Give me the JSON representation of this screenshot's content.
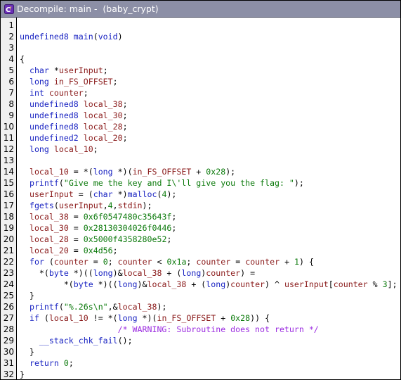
{
  "window": {
    "title": "Decompile: main -  (baby_crypt)",
    "icon": "ghidra-decompiler-icon"
  },
  "colors": {
    "titlebar": "#8c8fa6",
    "keyword": "#1a24c2",
    "variable": "#8a1a1a",
    "number_string": "#0c7a0c",
    "comment": "#9b2be0"
  },
  "code_lines": [
    [],
    [
      {
        "t": "undefined8",
        "c": "type"
      },
      {
        "t": " ",
        "c": "plain"
      },
      {
        "t": "main",
        "c": "func"
      },
      {
        "t": "(",
        "c": "plain"
      },
      {
        "t": "void",
        "c": "type"
      },
      {
        "t": ")",
        "c": "plain"
      }
    ],
    [],
    [
      {
        "t": "{",
        "c": "plain"
      }
    ],
    [
      {
        "t": "  ",
        "c": "plain"
      },
      {
        "t": "char",
        "c": "type"
      },
      {
        "t": " *",
        "c": "plain"
      },
      {
        "t": "userInput",
        "c": "var"
      },
      {
        "t": ";",
        "c": "plain"
      }
    ],
    [
      {
        "t": "  ",
        "c": "plain"
      },
      {
        "t": "long",
        "c": "type"
      },
      {
        "t": " ",
        "c": "plain"
      },
      {
        "t": "in_FS_OFFSET",
        "c": "var"
      },
      {
        "t": ";",
        "c": "plain"
      }
    ],
    [
      {
        "t": "  ",
        "c": "plain"
      },
      {
        "t": "int",
        "c": "type"
      },
      {
        "t": " ",
        "c": "plain"
      },
      {
        "t": "counter",
        "c": "var"
      },
      {
        "t": ";",
        "c": "plain"
      }
    ],
    [
      {
        "t": "  ",
        "c": "plain"
      },
      {
        "t": "undefined8",
        "c": "type"
      },
      {
        "t": " ",
        "c": "plain"
      },
      {
        "t": "local_38",
        "c": "var"
      },
      {
        "t": ";",
        "c": "plain"
      }
    ],
    [
      {
        "t": "  ",
        "c": "plain"
      },
      {
        "t": "undefined8",
        "c": "type"
      },
      {
        "t": " ",
        "c": "plain"
      },
      {
        "t": "local_30",
        "c": "var"
      },
      {
        "t": ";",
        "c": "plain"
      }
    ],
    [
      {
        "t": "  ",
        "c": "plain"
      },
      {
        "t": "undefined8",
        "c": "type"
      },
      {
        "t": " ",
        "c": "plain"
      },
      {
        "t": "local_28",
        "c": "var"
      },
      {
        "t": ";",
        "c": "plain"
      }
    ],
    [
      {
        "t": "  ",
        "c": "plain"
      },
      {
        "t": "undefined2",
        "c": "type"
      },
      {
        "t": " ",
        "c": "plain"
      },
      {
        "t": "local_20",
        "c": "var"
      },
      {
        "t": ";",
        "c": "plain"
      }
    ],
    [
      {
        "t": "  ",
        "c": "plain"
      },
      {
        "t": "long",
        "c": "type"
      },
      {
        "t": " ",
        "c": "plain"
      },
      {
        "t": "local_10",
        "c": "var"
      },
      {
        "t": ";",
        "c": "plain"
      }
    ],
    [],
    [
      {
        "t": "  ",
        "c": "plain"
      },
      {
        "t": "local_10",
        "c": "var"
      },
      {
        "t": " = *(",
        "c": "plain"
      },
      {
        "t": "long",
        "c": "type"
      },
      {
        "t": " *)(",
        "c": "plain"
      },
      {
        "t": "in_FS_OFFSET",
        "c": "var"
      },
      {
        "t": " + ",
        "c": "plain"
      },
      {
        "t": "0x28",
        "c": "num"
      },
      {
        "t": ");",
        "c": "plain"
      }
    ],
    [
      {
        "t": "  ",
        "c": "plain"
      },
      {
        "t": "printf",
        "c": "func"
      },
      {
        "t": "(",
        "c": "plain"
      },
      {
        "t": "\"Give me the key and I\\'ll give you the flag: \"",
        "c": "str"
      },
      {
        "t": ");",
        "c": "plain"
      }
    ],
    [
      {
        "t": "  ",
        "c": "plain"
      },
      {
        "t": "userInput",
        "c": "var"
      },
      {
        "t": " = (",
        "c": "plain"
      },
      {
        "t": "char",
        "c": "type"
      },
      {
        "t": " *)",
        "c": "plain"
      },
      {
        "t": "malloc",
        "c": "func"
      },
      {
        "t": "(",
        "c": "plain"
      },
      {
        "t": "4",
        "c": "num"
      },
      {
        "t": ");",
        "c": "plain"
      }
    ],
    [
      {
        "t": "  ",
        "c": "plain"
      },
      {
        "t": "fgets",
        "c": "func"
      },
      {
        "t": "(",
        "c": "plain"
      },
      {
        "t": "userInput",
        "c": "var"
      },
      {
        "t": ",",
        "c": "plain"
      },
      {
        "t": "4",
        "c": "num"
      },
      {
        "t": ",",
        "c": "plain"
      },
      {
        "t": "stdin",
        "c": "glob"
      },
      {
        "t": ");",
        "c": "plain"
      }
    ],
    [
      {
        "t": "  ",
        "c": "plain"
      },
      {
        "t": "local_38",
        "c": "var"
      },
      {
        "t": " = ",
        "c": "plain"
      },
      {
        "t": "0x6f0547480c35643f",
        "c": "num"
      },
      {
        "t": ";",
        "c": "plain"
      }
    ],
    [
      {
        "t": "  ",
        "c": "plain"
      },
      {
        "t": "local_30",
        "c": "var"
      },
      {
        "t": " = ",
        "c": "plain"
      },
      {
        "t": "0x28130304026f0446",
        "c": "num"
      },
      {
        "t": ";",
        "c": "plain"
      }
    ],
    [
      {
        "t": "  ",
        "c": "plain"
      },
      {
        "t": "local_28",
        "c": "var"
      },
      {
        "t": " = ",
        "c": "plain"
      },
      {
        "t": "0x5000f4358280e52",
        "c": "num"
      },
      {
        "t": ";",
        "c": "plain"
      }
    ],
    [
      {
        "t": "  ",
        "c": "plain"
      },
      {
        "t": "local_20",
        "c": "var"
      },
      {
        "t": " = ",
        "c": "plain"
      },
      {
        "t": "0x4d56",
        "c": "num"
      },
      {
        "t": ";",
        "c": "plain"
      }
    ],
    [
      {
        "t": "  ",
        "c": "plain"
      },
      {
        "t": "for",
        "c": "kw"
      },
      {
        "t": " (",
        "c": "plain"
      },
      {
        "t": "counter",
        "c": "var"
      },
      {
        "t": " = ",
        "c": "plain"
      },
      {
        "t": "0",
        "c": "num"
      },
      {
        "t": "; ",
        "c": "plain"
      },
      {
        "t": "counter",
        "c": "var"
      },
      {
        "t": " < ",
        "c": "plain"
      },
      {
        "t": "0x1a",
        "c": "num"
      },
      {
        "t": "; ",
        "c": "plain"
      },
      {
        "t": "counter",
        "c": "var"
      },
      {
        "t": " = ",
        "c": "plain"
      },
      {
        "t": "counter",
        "c": "var"
      },
      {
        "t": " + ",
        "c": "plain"
      },
      {
        "t": "1",
        "c": "num"
      },
      {
        "t": ") {",
        "c": "plain"
      }
    ],
    [
      {
        "t": "    *(",
        "c": "plain"
      },
      {
        "t": "byte",
        "c": "type"
      },
      {
        "t": " *)((",
        "c": "plain"
      },
      {
        "t": "long",
        "c": "type"
      },
      {
        "t": ")&",
        "c": "plain"
      },
      {
        "t": "local_38",
        "c": "var"
      },
      {
        "t": " + (",
        "c": "plain"
      },
      {
        "t": "long",
        "c": "type"
      },
      {
        "t": ")",
        "c": "plain"
      },
      {
        "t": "counter",
        "c": "var"
      },
      {
        "t": ") =",
        "c": "plain"
      }
    ],
    [
      {
        "t": "         *(",
        "c": "plain"
      },
      {
        "t": "byte",
        "c": "type"
      },
      {
        "t": " *)((",
        "c": "plain"
      },
      {
        "t": "long",
        "c": "type"
      },
      {
        "t": ")&",
        "c": "plain"
      },
      {
        "t": "local_38",
        "c": "var"
      },
      {
        "t": " + (",
        "c": "plain"
      },
      {
        "t": "long",
        "c": "type"
      },
      {
        "t": ")",
        "c": "plain"
      },
      {
        "t": "counter",
        "c": "var"
      },
      {
        "t": ") ^ ",
        "c": "plain"
      },
      {
        "t": "userInput",
        "c": "var"
      },
      {
        "t": "[",
        "c": "plain"
      },
      {
        "t": "counter",
        "c": "var"
      },
      {
        "t": " % ",
        "c": "plain"
      },
      {
        "t": "3",
        "c": "num"
      },
      {
        "t": "];",
        "c": "plain"
      }
    ],
    [
      {
        "t": "  }",
        "c": "plain"
      }
    ],
    [
      {
        "t": "  ",
        "c": "plain"
      },
      {
        "t": "printf",
        "c": "func"
      },
      {
        "t": "(",
        "c": "plain"
      },
      {
        "t": "\"%.26s\\n\"",
        "c": "str"
      },
      {
        "t": ",&",
        "c": "plain"
      },
      {
        "t": "local_38",
        "c": "var"
      },
      {
        "t": ");",
        "c": "plain"
      }
    ],
    [
      {
        "t": "  ",
        "c": "plain"
      },
      {
        "t": "if",
        "c": "kw"
      },
      {
        "t": " (",
        "c": "plain"
      },
      {
        "t": "local_10",
        "c": "var"
      },
      {
        "t": " != *(",
        "c": "plain"
      },
      {
        "t": "long",
        "c": "type"
      },
      {
        "t": " *)(",
        "c": "plain"
      },
      {
        "t": "in_FS_OFFSET",
        "c": "var"
      },
      {
        "t": " + ",
        "c": "plain"
      },
      {
        "t": "0x28",
        "c": "num"
      },
      {
        "t": ")) {",
        "c": "plain"
      }
    ],
    [
      {
        "t": "                    ",
        "c": "plain"
      },
      {
        "t": "/* WARNING: Subroutine does not return */",
        "c": "cmt"
      }
    ],
    [
      {
        "t": "    ",
        "c": "plain"
      },
      {
        "t": "__stack_chk_fail",
        "c": "func"
      },
      {
        "t": "();",
        "c": "plain"
      }
    ],
    [
      {
        "t": "  }",
        "c": "plain"
      }
    ],
    [
      {
        "t": "  ",
        "c": "plain"
      },
      {
        "t": "return",
        "c": "kw"
      },
      {
        "t": " ",
        "c": "plain"
      },
      {
        "t": "0",
        "c": "num"
      },
      {
        "t": ";",
        "c": "plain"
      }
    ],
    [
      {
        "t": "}",
        "c": "plain"
      }
    ]
  ]
}
